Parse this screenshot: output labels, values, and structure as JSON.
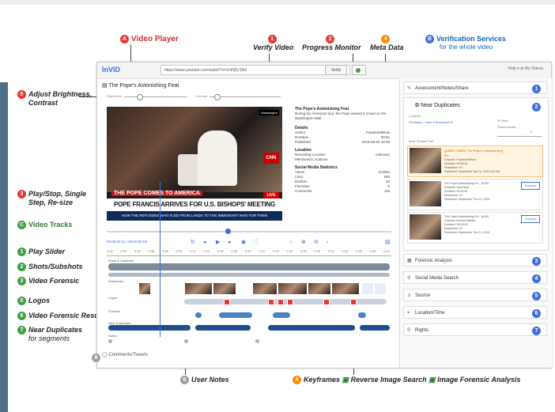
{
  "callouts": {
    "video_player": "Video Player",
    "verify_video": "Verify Video",
    "progress_monitor": "Progress Monitor",
    "meta_data": "Meta Data",
    "verification_services": "Verification Services",
    "verification_services_sub": "for the whole video",
    "adjust": "Adjust Brightness,",
    "adjust2": "Contrast",
    "play_stop": "Play/Stop, Single",
    "play_stop2": "Step, Re-size",
    "video_tracks": "Video Tracks",
    "play_slider": "Play Slider",
    "shots": "Shots/Subshots",
    "video_forensic": "Video Forensic",
    "logos": "Logos",
    "vf_result": "Video Forensic Result",
    "near_dup": "Near Duplicates",
    "near_dup_sub": "for segments",
    "user_notes": "User Notes",
    "keyframes": "Keyframes",
    "reverse_search": "Reverse Image Search",
    "image_forensic": "Image Forensic Analysis"
  },
  "badges": {
    "A": "A",
    "B": "B",
    "C": "C",
    "n1": "1",
    "n2": "2",
    "n3": "3",
    "n4": "4",
    "n5": "5",
    "n6": "6",
    "n7": "7",
    "n8": "8"
  },
  "app": {
    "logo": "InVID",
    "url": "https://www.youtube.com/watch?v=1hPjBj-SN4",
    "verify_label": "Verify",
    "top_right": "Help ▾   ⊕ My Videos",
    "video_title": "The Pope's Astonishing Feat",
    "brightness": "Brightness",
    "contrast": "Contrast",
    "time": "00:00:22.11 / 00:00:50.00",
    "comments": "Comments/Tweets"
  },
  "video": {
    "ticker1": "THE POPE COMES TO AMERICA",
    "ticker2": "POPE FRANCIS ARRIVES FOR U.S. BISHOPS' MEETING",
    "ticker3": "HOW THE REFUGEES WHO FLED FROM LANDS TO THE IMMIGRANT WHO FOR THEM",
    "cnn": "CNN",
    "live": "LIVE",
    "corner": "Washington"
  },
  "meta": {
    "title": "The Pope's Astonishing Feat",
    "desc": "During his American tour, the Pope wowed a crowd on the Washington Mall",
    "details_h": "Details",
    "details": [
      [
        "Author",
        "PopeDonttRow"
      ],
      [
        "Duration",
        "00:51"
      ],
      [
        "Published",
        "2015-09-24 15:08"
      ]
    ],
    "location_h": "Location",
    "location": [
      [
        "Recording Location",
        "unknown"
      ],
      [
        "Mentioned Locations",
        "-"
      ]
    ],
    "social_h": "Social Media Statistics",
    "social": [
      [
        "Views",
        "113664"
      ],
      [
        "Likes",
        "899"
      ],
      [
        "Dislikes",
        "33"
      ],
      [
        "Favorites",
        "0"
      ],
      [
        "Comments",
        "118"
      ]
    ]
  },
  "ruler": [
    "0:00",
    "0:02",
    "0:04",
    "0:06",
    "0:08",
    "0:10",
    "0:12",
    "0:14",
    "0:16",
    "0:18",
    "0:20",
    "0:22",
    "0:24",
    "0:26",
    "0:28",
    "0:30",
    "0:32",
    "0:34",
    "0:36",
    "0:38",
    "0:40"
  ],
  "tracks": {
    "shots": "Shots & Subshots",
    "keyframes": "Keyframes",
    "logos": "Logos",
    "forensic": "Forensic",
    "near_dup": "Near Duplicates",
    "notes": "Notes"
  },
  "right": {
    "assessment": "Assessment/Notes/Share",
    "near_dup_title": "Near Duplicates",
    "near_dup_count": "3 videos",
    "similarity": "Similarity: ▪ Date ▾ Resolution ▾",
    "show_results": "Show results:",
    "show_val": "5",
    "filter": "▼ Filter",
    "most_similar": "Most Similar First",
    "cards": [
      {
        "title": "QUERY VIDEO The Pope's Astonishing Fe...",
        "l2": "Channel: PopeDonttRow",
        "l3": "Duration: 00:00:51",
        "l4": "Resolution: HI",
        "l5": "Published: September Mar 31, 2015 (00:00)",
        "compare": ""
      },
      {
        "title": "The Pope's Astonishing Fe... (6:00)",
        "l2": "Channel: Vlad Neal",
        "l3": "Duration: 00:00:51",
        "l4": "Resolution: HI",
        "l5": "Published: September Thu 12, 2015",
        "compare": "Compare"
      },
      {
        "title": "The Pope's Astonishing Fe... (6:00)",
        "l2": "Channel: Ammon Bekker",
        "l3": "Duration: 00:00:52",
        "l4": "Resolution: HI",
        "l5": "Published: September Tue 11, 2015",
        "compare": "Compare"
      }
    ],
    "forensic": "Forensic Analysis",
    "social": "Social Media Search",
    "source": "Source",
    "location": "Location/Time",
    "rights": "Rights"
  }
}
